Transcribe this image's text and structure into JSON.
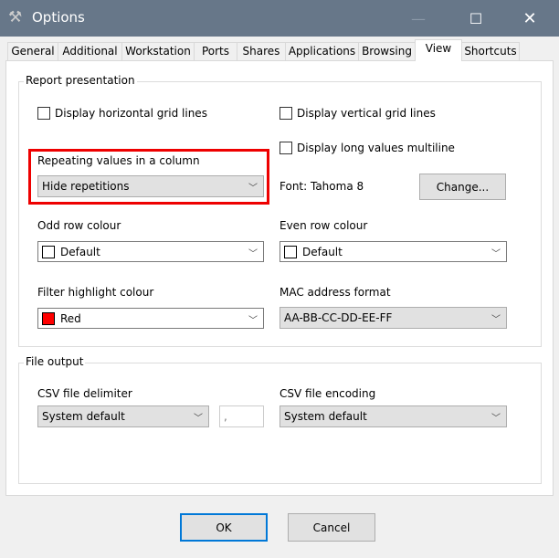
{
  "window": {
    "title": "Options",
    "icon": "tools-icon"
  },
  "tabs": [
    {
      "label": "General"
    },
    {
      "label": "Additional"
    },
    {
      "label": "Workstation"
    },
    {
      "label": "Ports"
    },
    {
      "label": "Shares"
    },
    {
      "label": "Applications"
    },
    {
      "label": "Browsing"
    },
    {
      "label": "View",
      "selected": true
    },
    {
      "label": "Shortcuts"
    }
  ],
  "report": {
    "group_label": "Report presentation",
    "horiz_grid": {
      "label": "Display horizontal grid lines",
      "checked": false
    },
    "vert_grid": {
      "label": "Display vertical grid lines",
      "checked": false
    },
    "long_multiline": {
      "label": "Display long values multiline",
      "checked": false
    },
    "repeating": {
      "label": "Repeating values in a column",
      "value": "Hide repetitions"
    },
    "font": {
      "label": "Font: Tahoma 8",
      "button": "Change..."
    },
    "odd_row": {
      "label": "Odd row colour",
      "value": "Default",
      "swatch": "#ffffff"
    },
    "even_row": {
      "label": "Even row colour",
      "value": "Default",
      "swatch": "#ffffff"
    },
    "filter": {
      "label": "Filter highlight colour",
      "value": "Red",
      "swatch": "#ff0000"
    },
    "mac": {
      "label": "MAC address format",
      "value": "AA-BB-CC-DD-EE-FF"
    }
  },
  "file": {
    "group_label": "File output",
    "delimiter": {
      "label": "CSV file delimiter",
      "value": "System default",
      "custom": ","
    },
    "encoding": {
      "label": "CSV file encoding",
      "value": "System default"
    }
  },
  "buttons": {
    "ok": "OK",
    "cancel": "Cancel"
  },
  "colors": {
    "highlight": "#ee0000",
    "titlebar": "#677789",
    "focus": "#0078d7"
  }
}
